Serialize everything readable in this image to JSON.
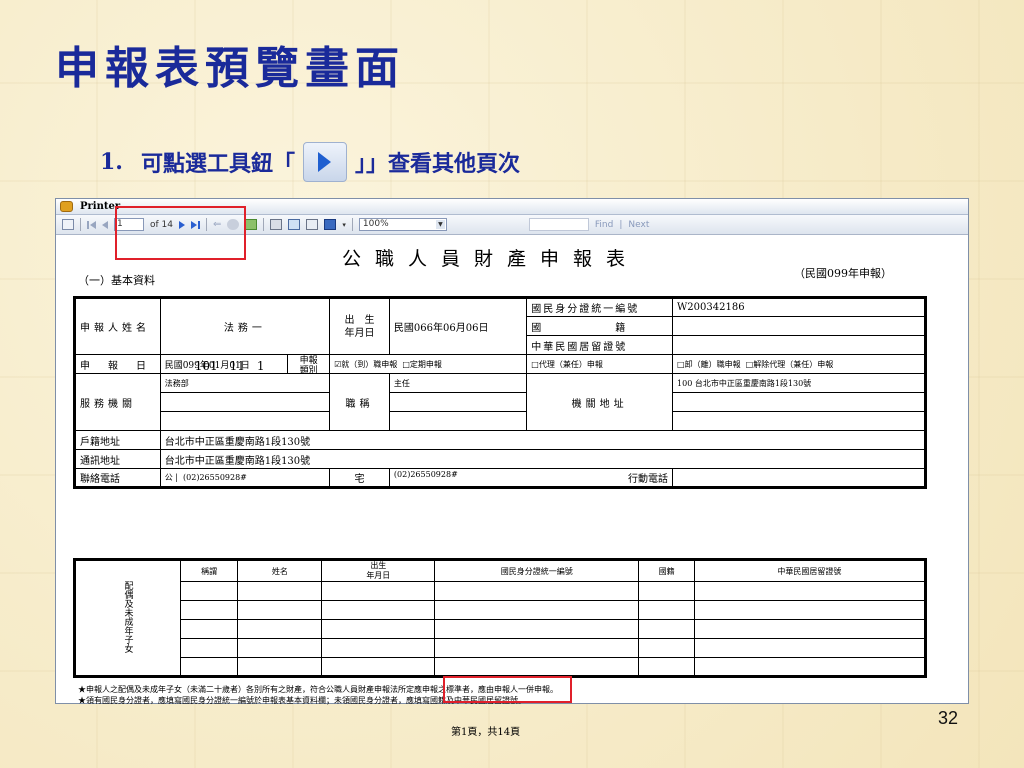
{
  "slide": {
    "title": "申報表預覽畫面",
    "step_number": "1.",
    "instruction_before": "可點選工具鈕「",
    "instruction_after": "」」查看其他頁次",
    "slide_number": "32"
  },
  "window": {
    "title": "Printer",
    "toolbar": {
      "page_value": "1",
      "page_total": "of 14",
      "zoom_value": "100%",
      "find_label": "Find",
      "separator": "|",
      "next_label": "Next"
    }
  },
  "report": {
    "title": "公職人員財產申報表",
    "section": "（一）基本資料",
    "year": "（民國099年申報）",
    "row1": {
      "name_label": "申報人姓名",
      "name_value": "法務一",
      "birth_label": "出　生\n年月日",
      "birth_value": "民國066年06月06日",
      "id_label": "國民身分證統一編號",
      "id_value": "W200342186",
      "nationality_label": "國　　　　　　籍",
      "residence_label": "中華民國居留證號"
    },
    "row2": {
      "date_label": "申　報　日",
      "date_value": "民國099年01月01日",
      "date_overlay": "101　11　1",
      "type_label": "申報\n類別",
      "opt1": "☑就（到）職申報",
      "opt2": "□定期申報",
      "opt3": "□代理（兼任）申報",
      "opt4": "□卸（離）職申報",
      "opt5": "□解除代理（兼任）申報"
    },
    "service": {
      "org_label": "服務機關",
      "org_value": "法務部",
      "title_label": "職稱",
      "title_value": "主任",
      "addr_label": "機關地址",
      "addr_value": "100 台北市中正區重慶南路1段130號"
    },
    "household_label": "戶籍地址",
    "household_value": "台北市中正區重慶南路1段130號",
    "mail_label": "通訊地址",
    "mail_value": "台北市中正區重慶南路1段130號",
    "phone_label": "聯絡電話",
    "phone_office_label": "公",
    "phone_office_value": "(02)26550928#",
    "phone_home_label": "宅",
    "phone_home_value": "(02)26550928#",
    "mobile_label": "行動電話",
    "family": {
      "side_label": "配偶及未成年子女",
      "headers": [
        "稱謂",
        "姓名",
        "出生\n年月日",
        "國民身分證統一編號",
        "國籍",
        "中華民國居留證號"
      ]
    },
    "footnote1": "★申報人之配偶及未成年子女（未滿二十歲者）各別所有之財產，符合公職人員財產申報法所定應申報之標準者，應由申報人一併申報。",
    "footnote2": "★領有國民身分證者，應填寫國民身分證統一編號於申報表基本資料欄；未領國民身分證者，應填寫國籍及中華民國居留證號。",
    "page_footer": "第1頁，共14頁"
  }
}
